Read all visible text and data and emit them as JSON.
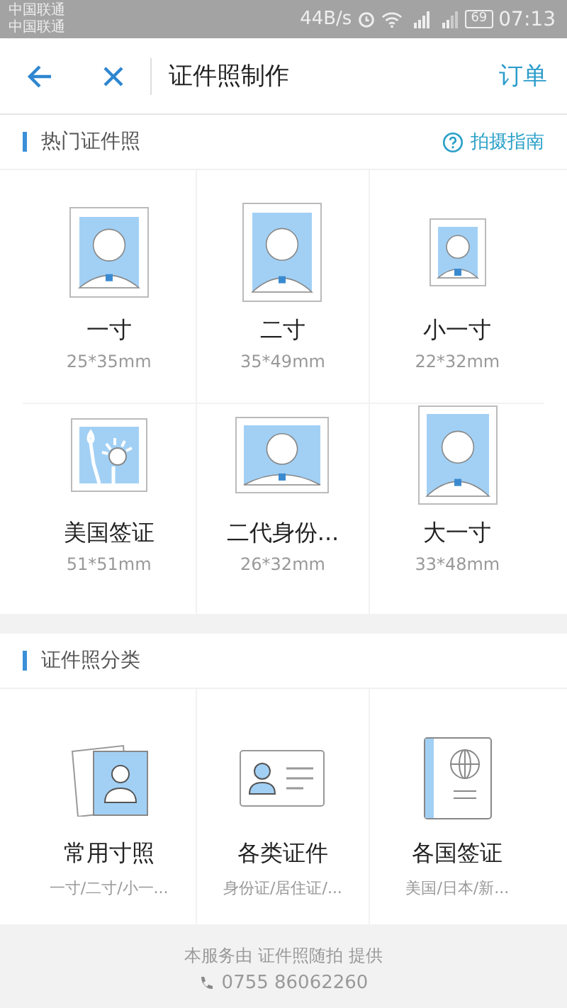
{
  "status_bar": {
    "carriers": [
      "中国联通",
      "中国联通"
    ],
    "speed": "44B/s",
    "battery": "69",
    "time": "07:13"
  },
  "header": {
    "title": "证件照制作",
    "action": "订单"
  },
  "hot": {
    "title": "热门证件照",
    "guide": "拍摄指南",
    "items": [
      {
        "kind": "portrait",
        "name": "一寸",
        "size": "25*35mm"
      },
      {
        "kind": "portrait",
        "name": "二寸",
        "size": "35*49mm"
      },
      {
        "kind": "portrait",
        "name": "小一寸",
        "size": "22*32mm"
      },
      {
        "kind": "statue",
        "name": "美国签证",
        "size": "51*51mm"
      },
      {
        "kind": "portrait",
        "name": "二代身份...",
        "size": "26*32mm"
      },
      {
        "kind": "portrait",
        "name": "大一寸",
        "size": "33*48mm"
      }
    ]
  },
  "categories": {
    "title": "证件照分类",
    "items": [
      {
        "kind": "photos",
        "name": "常用寸照",
        "detail": "一寸/二寸/小一..."
      },
      {
        "kind": "id-card",
        "name": "各类证件",
        "detail": "身份证/居住证/..."
      },
      {
        "kind": "passport",
        "name": "各国签证",
        "detail": "美国/日本/新..."
      }
    ]
  },
  "footer": {
    "provider": "本服务由 证件照随拍 提供",
    "phone": "0755 86062260"
  }
}
